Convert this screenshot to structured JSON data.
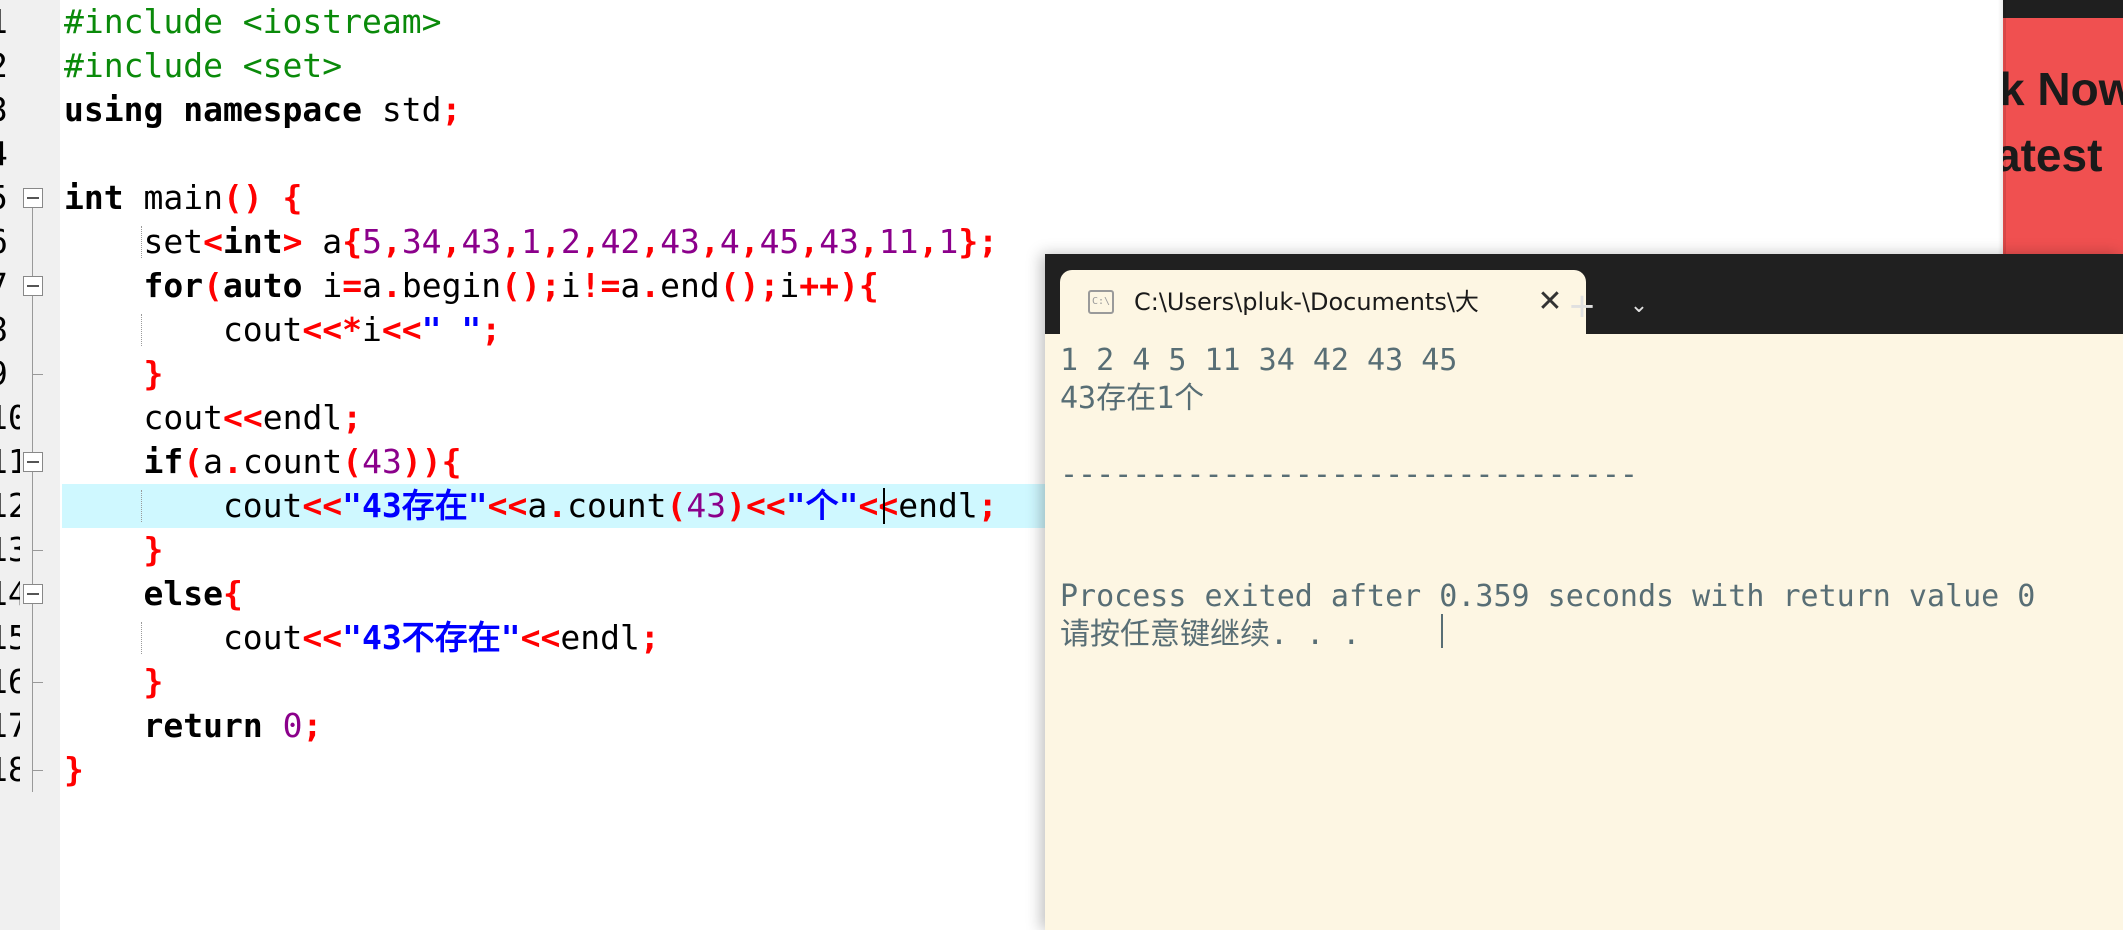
{
  "editor": {
    "line_numbers": [
      "1",
      "2",
      "3",
      "4",
      "5",
      "6",
      "7",
      "8",
      "9",
      "10",
      "11",
      "12",
      "13",
      "14",
      "15",
      "16",
      "17",
      "18"
    ],
    "lines": [
      [
        {
          "t": "#include <iostream>",
          "c": "pp"
        }
      ],
      [
        {
          "t": "#include <set>",
          "c": "pp"
        }
      ],
      [
        {
          "t": "using namespace",
          "c": "kw"
        },
        {
          "t": " std"
        },
        {
          "t": ";",
          "c": "sym"
        }
      ],
      [],
      [
        {
          "t": "int",
          "c": "kw"
        },
        {
          "t": " main"
        },
        {
          "t": "() {",
          "c": "sym"
        }
      ],
      [
        {
          "t": "    set"
        },
        {
          "t": "<",
          "c": "sym"
        },
        {
          "t": "int",
          "c": "kw"
        },
        {
          "t": ">",
          "c": "sym"
        },
        {
          "t": " a"
        },
        {
          "t": "{",
          "c": "sym"
        },
        {
          "t": "5",
          "c": "num"
        },
        {
          "t": ",",
          "c": "sym"
        },
        {
          "t": "34",
          "c": "num"
        },
        {
          "t": ",",
          "c": "sym"
        },
        {
          "t": "43",
          "c": "num"
        },
        {
          "t": ",",
          "c": "sym"
        },
        {
          "t": "1",
          "c": "num"
        },
        {
          "t": ",",
          "c": "sym"
        },
        {
          "t": "2",
          "c": "num"
        },
        {
          "t": ",",
          "c": "sym"
        },
        {
          "t": "42",
          "c": "num"
        },
        {
          "t": ",",
          "c": "sym"
        },
        {
          "t": "43",
          "c": "num"
        },
        {
          "t": ",",
          "c": "sym"
        },
        {
          "t": "4",
          "c": "num"
        },
        {
          "t": ",",
          "c": "sym"
        },
        {
          "t": "45",
          "c": "num"
        },
        {
          "t": ",",
          "c": "sym"
        },
        {
          "t": "43",
          "c": "num"
        },
        {
          "t": ",",
          "c": "sym"
        },
        {
          "t": "11",
          "c": "num"
        },
        {
          "t": ",",
          "c": "sym"
        },
        {
          "t": "1",
          "c": "num"
        },
        {
          "t": "};",
          "c": "sym"
        }
      ],
      [
        {
          "t": "    "
        },
        {
          "t": "for",
          "c": "kw"
        },
        {
          "t": "(",
          "c": "sym"
        },
        {
          "t": "auto",
          "c": "kw"
        },
        {
          "t": " i"
        },
        {
          "t": "=",
          "c": "sym"
        },
        {
          "t": "a"
        },
        {
          "t": ".",
          "c": "sym"
        },
        {
          "t": "begin"
        },
        {
          "t": "();",
          "c": "sym"
        },
        {
          "t": "i"
        },
        {
          "t": "!=",
          "c": "sym"
        },
        {
          "t": "a"
        },
        {
          "t": ".",
          "c": "sym"
        },
        {
          "t": "end"
        },
        {
          "t": "();",
          "c": "sym"
        },
        {
          "t": "i"
        },
        {
          "t": "++){",
          "c": "sym"
        }
      ],
      [
        {
          "t": "        cout"
        },
        {
          "t": "<<*",
          "c": "sym"
        },
        {
          "t": "i"
        },
        {
          "t": "<<",
          "c": "sym"
        },
        {
          "t": "\" \"",
          "c": "str"
        },
        {
          "t": ";",
          "c": "sym"
        }
      ],
      [
        {
          "t": "    "
        },
        {
          "t": "}",
          "c": "sym"
        }
      ],
      [
        {
          "t": "    cout"
        },
        {
          "t": "<<",
          "c": "sym"
        },
        {
          "t": "endl"
        },
        {
          "t": ";",
          "c": "sym"
        }
      ],
      [
        {
          "t": "    "
        },
        {
          "t": "if",
          "c": "kw"
        },
        {
          "t": "(",
          "c": "sym"
        },
        {
          "t": "a"
        },
        {
          "t": ".",
          "c": "sym"
        },
        {
          "t": "count"
        },
        {
          "t": "(",
          "c": "sym"
        },
        {
          "t": "43",
          "c": "num"
        },
        {
          "t": ")){",
          "c": "sym"
        }
      ],
      [
        {
          "t": "        cout"
        },
        {
          "t": "<<",
          "c": "sym"
        },
        {
          "t": "\"43存在\"",
          "c": "str"
        },
        {
          "t": "<<",
          "c": "sym"
        },
        {
          "t": "a"
        },
        {
          "t": ".",
          "c": "sym"
        },
        {
          "t": "count"
        },
        {
          "t": "(",
          "c": "sym"
        },
        {
          "t": "43",
          "c": "num"
        },
        {
          "t": ")<<",
          "c": "sym"
        },
        {
          "t": "\"个\"",
          "c": "str"
        },
        {
          "t": "<<",
          "c": "sym"
        },
        {
          "t": "endl"
        },
        {
          "t": ";",
          "c": "sym"
        }
      ],
      [
        {
          "t": "    "
        },
        {
          "t": "}",
          "c": "sym"
        }
      ],
      [
        {
          "t": "    "
        },
        {
          "t": "else",
          "c": "kw"
        },
        {
          "t": "{",
          "c": "sym"
        }
      ],
      [
        {
          "t": "        cout"
        },
        {
          "t": "<<",
          "c": "sym"
        },
        {
          "t": "\"43不存在\"",
          "c": "str"
        },
        {
          "t": "<<",
          "c": "sym"
        },
        {
          "t": "endl"
        },
        {
          "t": ";",
          "c": "sym"
        }
      ],
      [
        {
          "t": "    "
        },
        {
          "t": "}",
          "c": "sym"
        }
      ],
      [
        {
          "t": "    "
        },
        {
          "t": "return",
          "c": "kw"
        },
        {
          "t": " "
        },
        {
          "t": "0",
          "c": "num"
        },
        {
          "t": ";",
          "c": "sym"
        }
      ],
      [
        {
          "t": "}",
          "c": "sym"
        }
      ]
    ],
    "highlighted_line": 12
  },
  "thumbnail": {
    "line1": "k Now",
    "line2": "atest"
  },
  "terminal": {
    "tab_title": "C:\\Users\\pluk-\\Documents\\大",
    "tab_icon": "terminal-icon",
    "close_symbol": "✕",
    "new_tab_symbol": "+",
    "dropdown_symbol": "⌄",
    "output": [
      "1 2 4 5 11 34 42 43 45",
      "43存在1个",
      "",
      "--------------------------------",
      "Process exited after 0.359 seconds with return value 0",
      "请按任意键继续. . ."
    ]
  },
  "colors": {
    "preprocessor": "#0a8a0a",
    "symbol": "#ff0000",
    "number": "#8b008b",
    "string": "#0000ff",
    "current_line_highlight": "#cff8ff",
    "terminal_background": "#fdf6e3",
    "terminal_text": "#586e75",
    "titlebar": "#202020"
  }
}
